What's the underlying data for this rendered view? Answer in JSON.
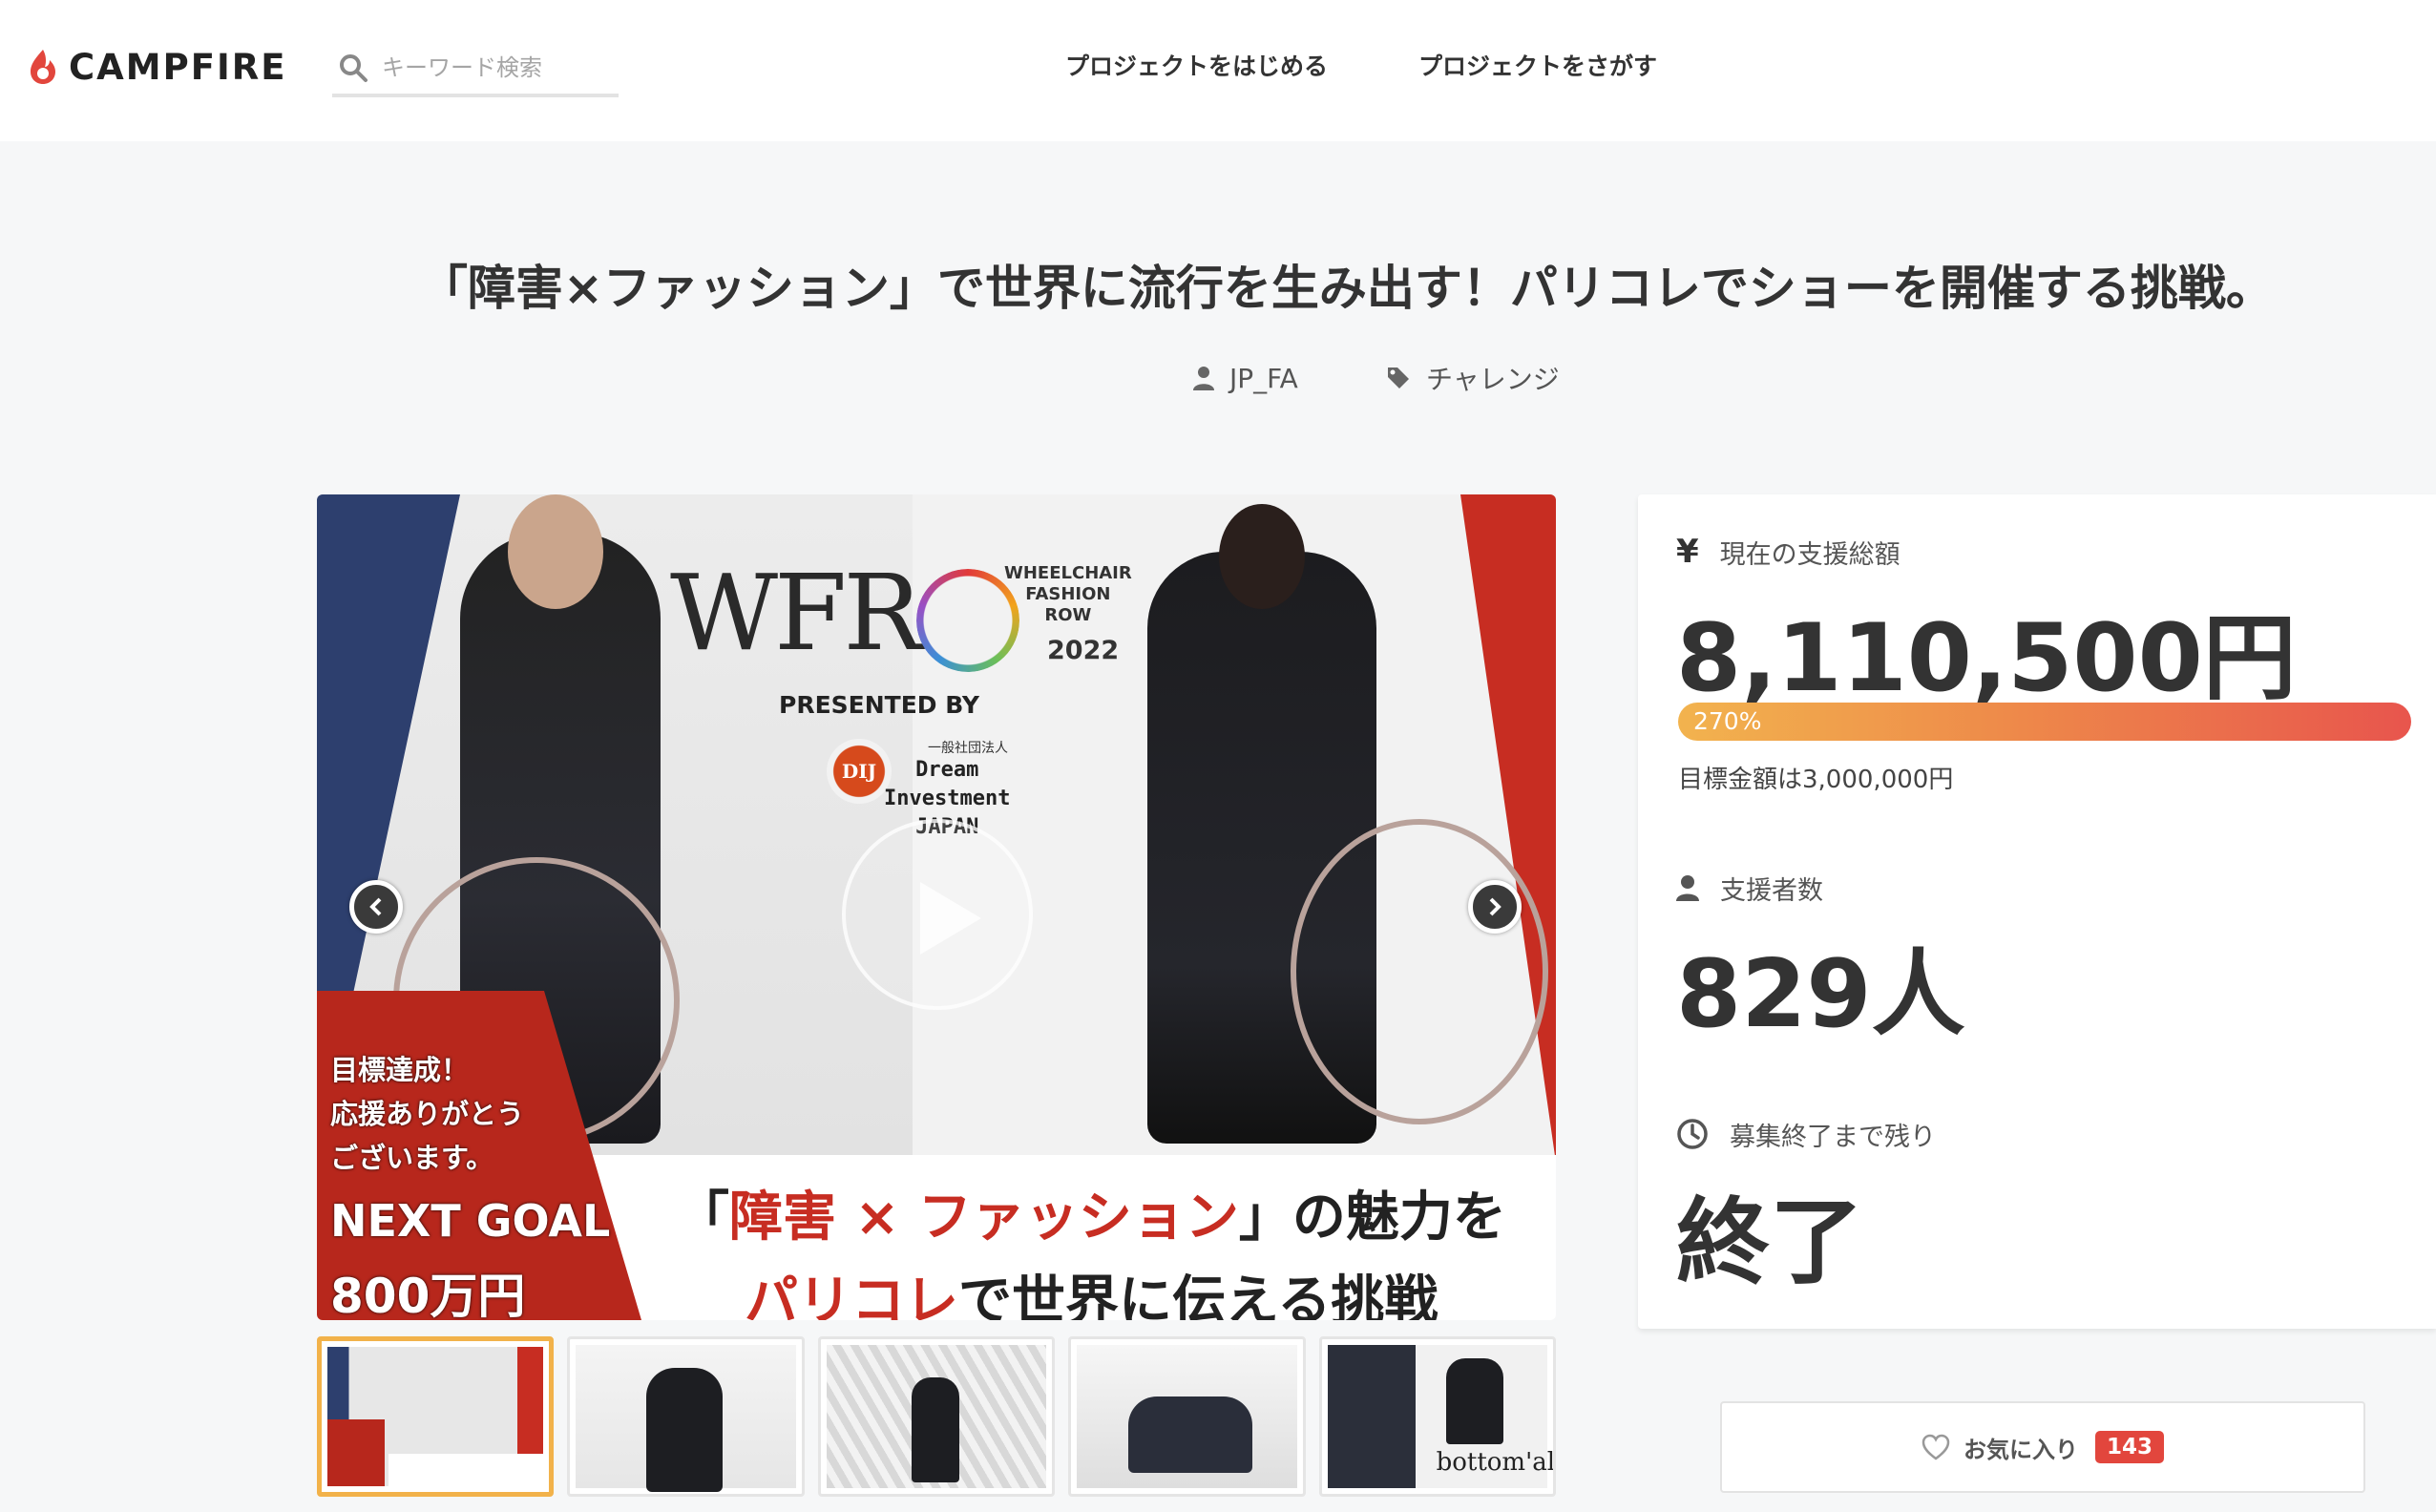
{
  "header": {
    "logo_text": "CAMPFIRE",
    "search_placeholder": "キーワード検索",
    "nav": [
      "プロジェクトをはじめる",
      "プロジェクトをさがす"
    ]
  },
  "project": {
    "title": "「障害×ファッション」で世界に流行を生み出す！パリコレでショーを開催する挑戦。",
    "owner": "JP_FA",
    "category": "チャレンジ"
  },
  "hero": {
    "brand": "WFR",
    "brand_sub": [
      "WHEELCHAIR",
      "FASHION",
      "ROW"
    ],
    "year": "2022",
    "presented_by": "PRESENTED BY",
    "org_small": "一般社団法人",
    "org_badge": "DIJ",
    "org_name": [
      "Dream",
      "Investment",
      "JAPAN"
    ],
    "goal_lines": [
      "目標達成！",
      "応援ありがとう",
      "ございます。"
    ],
    "next_goal": "NEXT GOAL",
    "next_goal_amount": "800万円",
    "tagline1_open": "「",
    "tagline1_red": "障害 × ファッション",
    "tagline1_rest": "」の魅力を",
    "tagline2_red": "パリコレ",
    "tagline2_rest": "で世界に伝える挑戦"
  },
  "stats": {
    "currency_symbol": "¥",
    "amount_label": "現在の支援総額",
    "amount": "8,110,500円",
    "progress_percent": 270,
    "progress_label": "270%",
    "goal_note": "目標金額は3,000,000円",
    "backers_label": "支援者数",
    "backers": "829人",
    "remaining_label": "募集終了まで残り",
    "remaining": "終了"
  },
  "favorite": {
    "label": "お気に入り",
    "count": "143"
  },
  "thumbnail_captions": [
    "bottom'all"
  ],
  "colors": {
    "brand_red": "#e2463d",
    "progress_start": "#f2b34e",
    "progress_end": "#e8554d",
    "thumb_active": "#f2b24a"
  }
}
